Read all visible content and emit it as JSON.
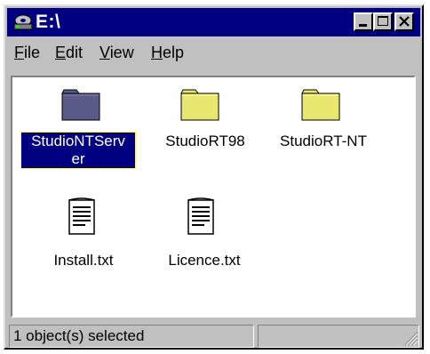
{
  "window": {
    "title": "E:\\"
  },
  "menu": [
    {
      "accel": "F",
      "rest": "ile"
    },
    {
      "accel": "E",
      "rest": "dit"
    },
    {
      "accel": "V",
      "rest": "iew"
    },
    {
      "accel": "H",
      "rest": "elp"
    }
  ],
  "files": [
    {
      "line1": "StudioNTServ",
      "line2": "er",
      "type": "folder-dark",
      "selected": true
    },
    {
      "line1": "StudioRT98",
      "line2": "",
      "type": "folder"
    },
    {
      "line1": "StudioRT-NT",
      "line2": "",
      "type": "folder"
    },
    {
      "line1": "Install.txt",
      "line2": "",
      "type": "text-file"
    },
    {
      "line1": "Licence.txt",
      "line2": "",
      "type": "text-file"
    }
  ],
  "status": {
    "text": "1 object(s) selected"
  },
  "colors": {
    "titlebar": "#000080",
    "selection": "#000080",
    "folder": "#e8e870",
    "folder_selected": "#5a5a88"
  },
  "icons": [
    "drive-icon",
    "minimize-icon",
    "maximize-icon",
    "close-icon",
    "folder-icon",
    "text-file-icon",
    "resize-grip-icon"
  ]
}
